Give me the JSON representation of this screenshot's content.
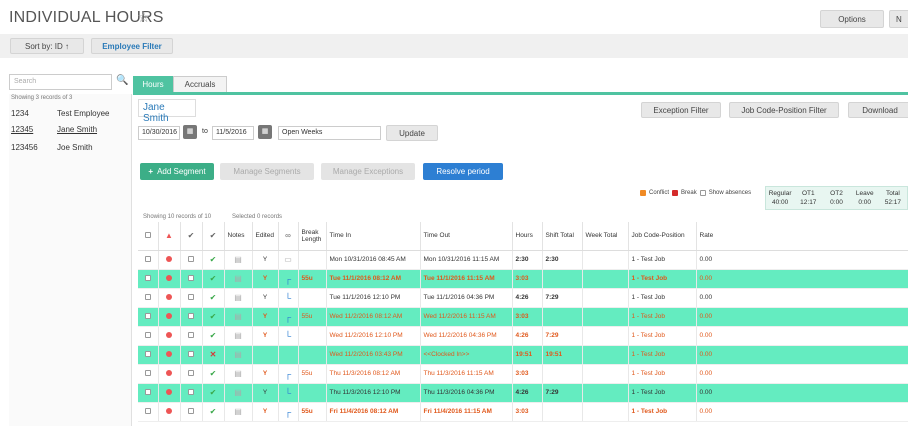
{
  "header": {
    "title": "INDIVIDUAL HOURS",
    "star_icon": "star-icon",
    "options_label": "Options",
    "next_label": "N"
  },
  "sortbar": {
    "sort_label": "Sort by: ID ↑",
    "employee_filter_label": "Employee Filter"
  },
  "search": {
    "placeholder": "Search"
  },
  "employees": {
    "showing": "Showing 3 records of 3",
    "list": [
      {
        "id": "1234",
        "name": "Test Employee"
      },
      {
        "id": "12345",
        "name": "Jane Smith"
      },
      {
        "id": "123456",
        "name": "Joe Smith"
      }
    ]
  },
  "tabs": {
    "hours": "Hours",
    "accruals": "Accruals"
  },
  "toolbar": {
    "employee_name": "Jane Smith",
    "exception_filter": "Exception Filter",
    "job_code_filter": "Job Code-Position Filter",
    "download": "Download",
    "date_from": "10/30/2016",
    "to": "to",
    "date_to": "11/5/2016",
    "period": "Open Weeks",
    "update": "Update"
  },
  "actions": {
    "add_segment": "Add Segment",
    "manage_segments": "Manage Segments",
    "manage_exceptions": "Manage Exceptions",
    "resolve_period": "Resolve period"
  },
  "legend": {
    "conflict": "Conflict",
    "break": "Break",
    "show_absences": "Show absences"
  },
  "totals": [
    {
      "label": "Regular",
      "value": "40:00"
    },
    {
      "label": "OT1",
      "value": "12:17"
    },
    {
      "label": "OT2",
      "value": "0:00"
    },
    {
      "label": "Leave",
      "value": "0:00"
    },
    {
      "label": "Total",
      "value": "52:17"
    }
  ],
  "grid_info": {
    "showing": "Showing 10 records of 10",
    "selected": "Selected 0 records"
  },
  "columns": {
    "notes": "Notes",
    "edited": "Edited",
    "break_length": "Break Length",
    "time_in": "Time In",
    "time_out": "Time Out",
    "hours": "Hours",
    "shift_total": "Shift Total",
    "week_total": "Week Total",
    "job_code": "Job Code-Position",
    "rate": "Rate"
  },
  "rows": [
    {
      "status": "ok",
      "edited": "Y",
      "flag": "doc",
      "brk": "",
      "in": "Mon 10/31/2016 08:45 AM",
      "out": "Mon 10/31/2016 11:15 AM",
      "hours": "2:30",
      "shift": "2:30",
      "week": "",
      "job": "1 - Test Job",
      "rate": "0.00",
      "hl": false,
      "tone": "plain"
    },
    {
      "status": "ok",
      "edited": "Y",
      "flag": "top",
      "brk": "55u",
      "in": "Tue 11/1/2016 08:12 AM",
      "out": "Tue 11/1/2016 11:15 AM",
      "hours": "3:03",
      "shift": "",
      "week": "",
      "job": "1 - Test Job",
      "rate": "0.00",
      "hl": true,
      "tone": "red"
    },
    {
      "status": "ok",
      "edited": "Y",
      "flag": "bottom",
      "brk": "",
      "in": "Tue 11/1/2016 12:10 PM",
      "out": "Tue 11/1/2016 04:36 PM",
      "hours": "4:26",
      "shift": "7:29",
      "week": "",
      "job": "1 - Test Job",
      "rate": "0.00",
      "hl": false,
      "tone": "plain"
    },
    {
      "status": "ok",
      "edited": "Y",
      "flag": "top",
      "brk": "55u",
      "in": "Wed 11/2/2016 08:12 AM",
      "out": "Wed 11/2/2016 11:15 AM",
      "hours": "3:03",
      "shift": "",
      "week": "",
      "job": "1 - Test Job",
      "rate": "0.00",
      "hl": true,
      "tone": "orange"
    },
    {
      "status": "ok",
      "edited": "Y",
      "flag": "bottom",
      "brk": "",
      "in": "Wed 11/2/2016 12:10 PM",
      "out": "Wed 11/2/2016 04:36 PM",
      "hours": "4:26",
      "shift": "7:29",
      "week": "",
      "job": "1 - Test Job",
      "rate": "0.00",
      "hl": false,
      "tone": "orange"
    },
    {
      "status": "bad",
      "edited": "",
      "flag": "none",
      "brk": "",
      "in": "Wed 11/2/2016 03:43 PM",
      "out": "<<Clocked In>>",
      "hours": "19:51",
      "shift": "19:51",
      "week": "",
      "job": "1 - Test Job",
      "rate": "0.00",
      "hl": true,
      "tone": "orange"
    },
    {
      "status": "ok",
      "edited": "Y",
      "flag": "top",
      "brk": "55u",
      "in": "Thu 11/3/2016 08:12 AM",
      "out": "Thu 11/3/2016 11:15 AM",
      "hours": "3:03",
      "shift": "",
      "week": "",
      "job": "1 - Test Job",
      "rate": "0.00",
      "hl": false,
      "tone": "orange"
    },
    {
      "status": "ok",
      "edited": "Y",
      "flag": "bottom",
      "brk": "",
      "in": "Thu 11/3/2016 12:10 PM",
      "out": "Thu 11/3/2016 04:36 PM",
      "hours": "4:26",
      "shift": "7:29",
      "week": "",
      "job": "1 - Test Job",
      "rate": "0.00",
      "hl": true,
      "tone": "plain"
    },
    {
      "status": "ok",
      "edited": "Y",
      "flag": "top",
      "brk": "55u",
      "in": "Fri 11/4/2016 08:12 AM",
      "out": "Fri 11/4/2016 11:15 AM",
      "hours": "3:03",
      "shift": "",
      "week": "",
      "job": "1 - Test Job",
      "rate": "0.00",
      "hl": false,
      "tone": "red"
    }
  ]
}
